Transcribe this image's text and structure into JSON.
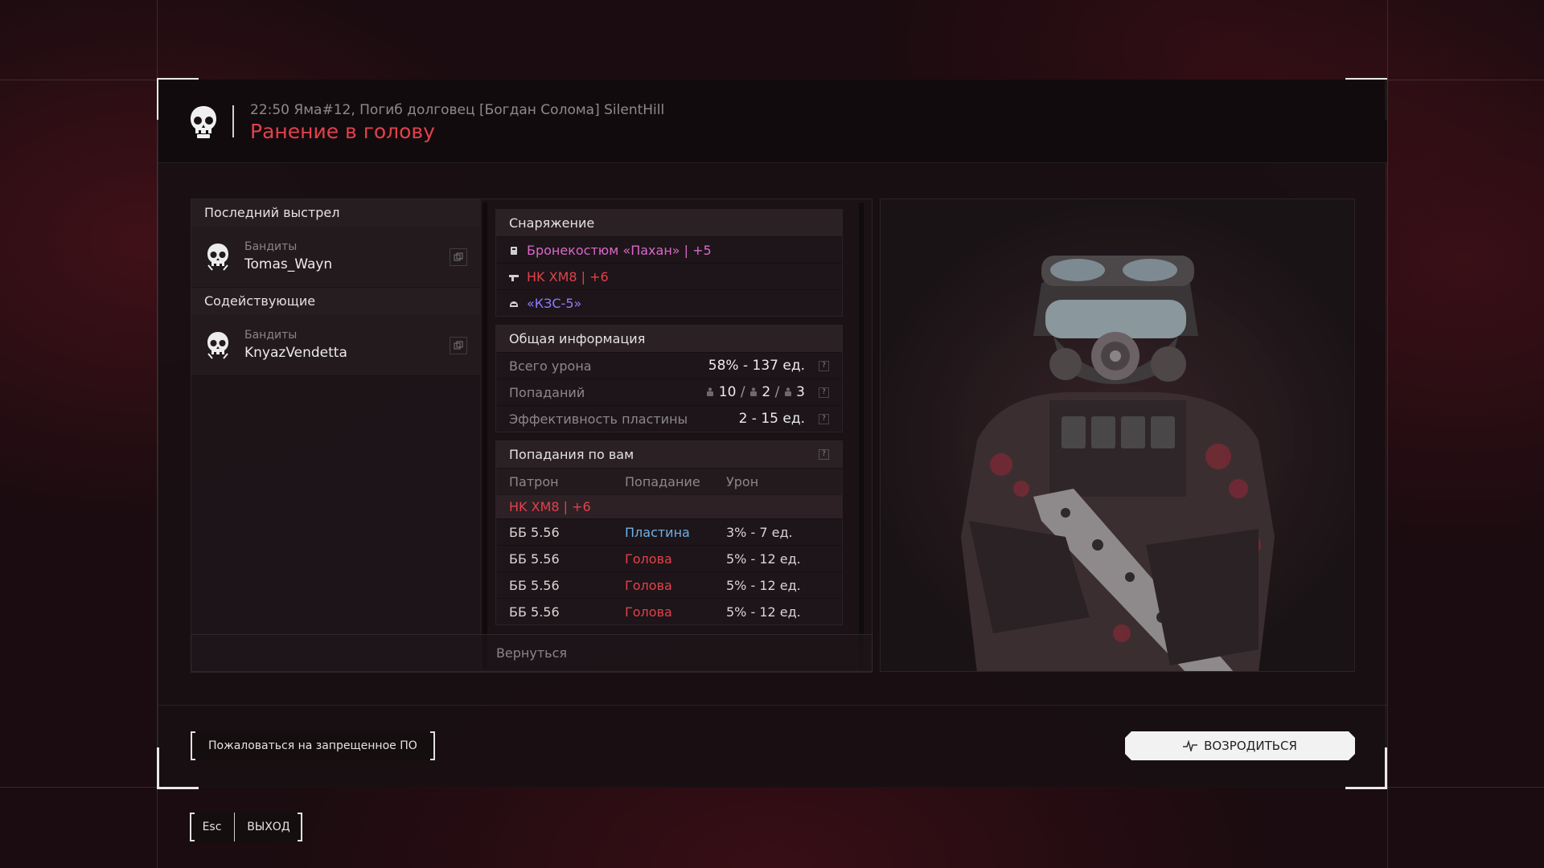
{
  "header": {
    "event_line": "22:50 Яма#12, Погиб долговец [Богдан Солома] SilentHill",
    "death_cause": "Ранение в голову"
  },
  "left": {
    "last_shot_title": "Последний выстрел",
    "killer": {
      "faction": "Бандиты",
      "name": "Tomas_Wayn"
    },
    "assist_title": "Содействующие",
    "assist": {
      "faction": "Бандиты",
      "name": "KnyazVendetta"
    }
  },
  "equipment": {
    "title": "Снаряжение",
    "items": [
      {
        "label": "Бронекостюм «Пахан» | +5",
        "color": "#d968c9",
        "icon": "armor-icon"
      },
      {
        "label": "HK XM8 | +6",
        "color": "#e2414b",
        "icon": "rifle-icon"
      },
      {
        "label": "«КЗС-5»",
        "color": "#8f7dff",
        "icon": "helmet-icon"
      }
    ]
  },
  "general": {
    "title": "Общая информация",
    "total_damage_label": "Всего урона",
    "total_damage_value": "58% - 137 ед.",
    "hits_label": "Попаданий",
    "hits_a": "10",
    "hits_b": "2",
    "hits_c": "3",
    "plate_label": "Эффективность пластины",
    "plate_value": "2 - 15 ед."
  },
  "hits_on_you": {
    "title": "Попадания по вам",
    "columns": [
      "Патрон",
      "Попадание",
      "Урон"
    ],
    "weapon": "HK XM8 | +6",
    "rows": [
      {
        "ammo": "ББ 5.56",
        "hit": "Пластина",
        "hit_color": "#6fb0e6",
        "damage": "3% - 7 ед."
      },
      {
        "ammo": "ББ 5.56",
        "hit": "Голова",
        "hit_color": "#e2414b",
        "damage": "5% - 12 ед."
      },
      {
        "ammo": "ББ 5.56",
        "hit": "Голова",
        "hit_color": "#e2414b",
        "damage": "5% - 12 ед."
      },
      {
        "ammo": "ББ 5.56",
        "hit": "Голова",
        "hit_color": "#e2414b",
        "damage": "5% - 12 ед."
      }
    ]
  },
  "buttons": {
    "back": "Вернуться",
    "report": "Пожаловаться на запрещенное ПО",
    "respawn": "ВОЗРОДИТЬСЯ",
    "esc_key": "Esc",
    "exit": "ВЫХОД"
  }
}
